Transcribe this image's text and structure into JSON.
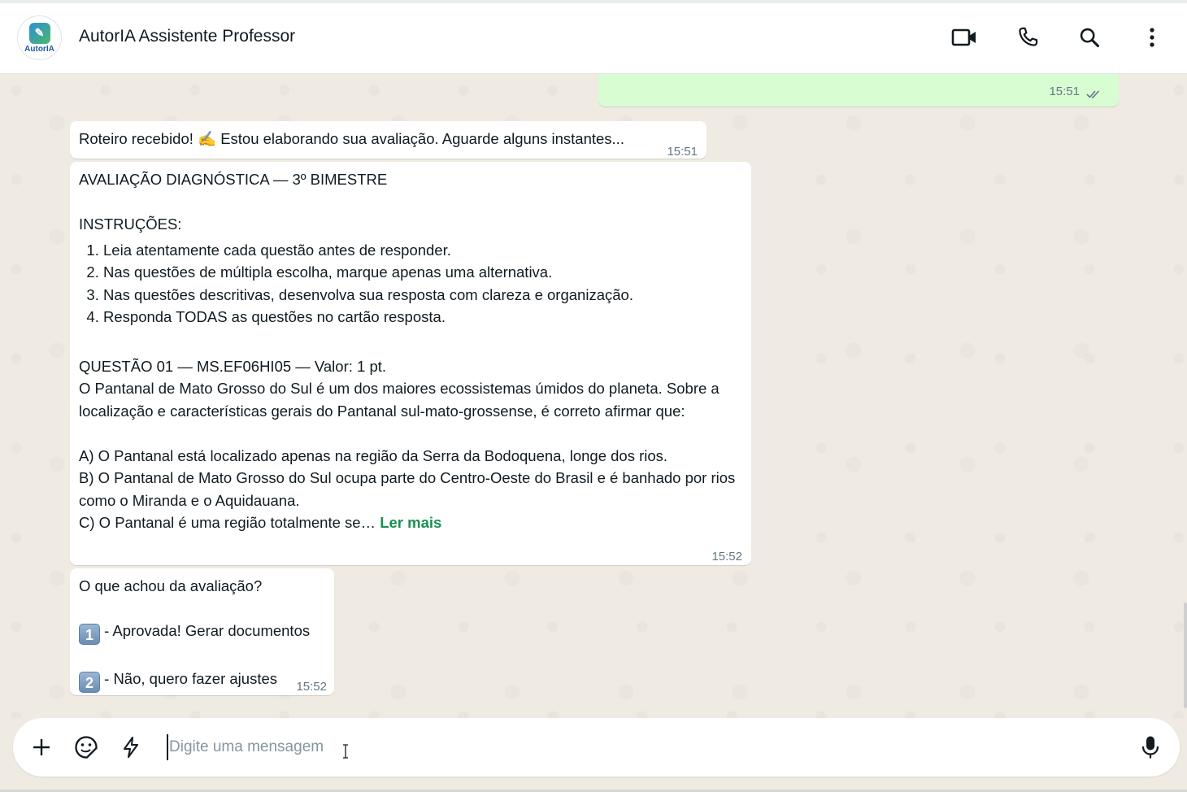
{
  "header": {
    "title": "AutorIA Assistente Professor",
    "avatar_text": "AutorIA",
    "icons": [
      "video-call-icon",
      "voice-call-icon",
      "search-icon",
      "menu-icon"
    ]
  },
  "messages": {
    "outgoing_top": {
      "time": "15:51",
      "status": "read"
    },
    "received": {
      "text": "Roteiro recebido! ✍️ Estou elaborando sua avaliação. Aguarde alguns instantes...",
      "time": "15:51"
    },
    "assessment": {
      "heading": "AVALIAÇÃO DIAGNÓSTICA — 3º BIMESTRE",
      "instructions_label": "INSTRUÇÕES:",
      "instructions": [
        "Leia atentamente cada questão antes de responder.",
        "Nas questões de múltipla escolha, marque apenas uma alternativa.",
        "Nas questões descritivas, desenvolva sua resposta com clareza e organização.",
        "Responda TODAS as questões no cartão resposta."
      ],
      "question_header": "QUESTÃO 01 — MS.EF06HI05 — Valor: 1 pt.",
      "question_text": "O Pantanal de Mato Grosso do Sul é um dos maiores ecossistemas úmidos do planeta. Sobre a localização e características gerais do Pantanal sul-mato-grossense, é correto afirmar que:",
      "option_a": "A) O Pantanal está localizado apenas na região da Serra da Bodoquena, longe dos rios.",
      "option_b": "B) O Pantanal de Mato Grosso do Sul ocupa parte do Centro-Oeste do Brasil e é banhado por rios como o Miranda e o Aquidauana.",
      "option_c": "C) O Pantanal é uma região totalmente se…",
      "read_more": "Ler mais",
      "time": "15:52"
    },
    "feedback": {
      "question": "O que achou da avaliação?",
      "opt1_key": "1",
      "opt1": " - Aprovada! Gerar documentos",
      "opt2_key": "2",
      "opt2": " - Não, quero fazer ajustes",
      "time": "15:52"
    }
  },
  "composer": {
    "placeholder": "Digite uma mensagem",
    "value": "",
    "icons": [
      "plus-icon",
      "sticker-icon",
      "lightning-icon",
      "microphone-icon"
    ]
  },
  "colors": {
    "accent_green": "#1c8f54",
    "outgoing_bubble": "#d9fdd3",
    "chat_bg": "#efeae2"
  }
}
